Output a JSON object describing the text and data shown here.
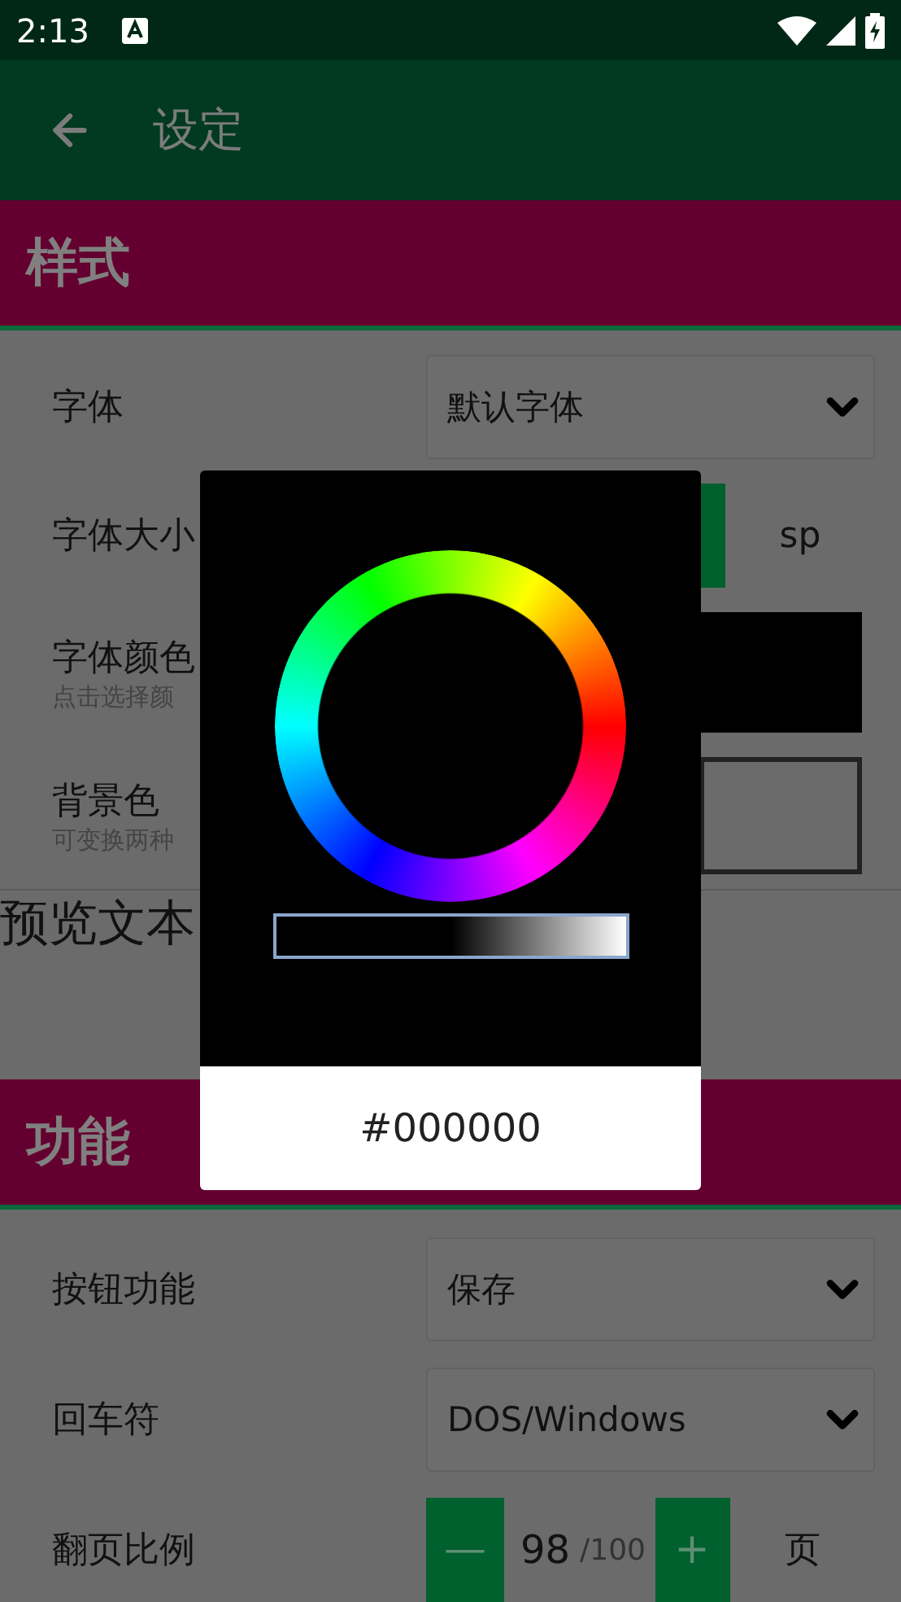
{
  "status_bar": {
    "time": "2:13"
  },
  "app_bar": {
    "title": "设定"
  },
  "sections": [
    {
      "title": "样式",
      "rows": [
        {
          "kind": "dropdown",
          "label": "字体",
          "value": "默认字体"
        },
        {
          "kind": "partial_stepper",
          "label": "字体大小",
          "unit": "sp"
        },
        {
          "kind": "swatch",
          "label": "字体颜色",
          "hint": "点击选择颜",
          "filled": true
        },
        {
          "kind": "swatch",
          "label": "背景色",
          "hint": "可变换两种",
          "filled": false
        }
      ],
      "preview": "预览文本"
    },
    {
      "title": "功能",
      "rows": [
        {
          "kind": "dropdown",
          "label": "按钮功能",
          "value": "保存"
        },
        {
          "kind": "dropdown",
          "label": "回车符",
          "value": "DOS/Windows"
        },
        {
          "kind": "stepper",
          "label": "翻页比例",
          "minus": "—",
          "value": "98",
          "suffix": "/100",
          "plus": "+",
          "unit": "页"
        }
      ]
    }
  ],
  "dialog": {
    "hex": "#000000"
  }
}
